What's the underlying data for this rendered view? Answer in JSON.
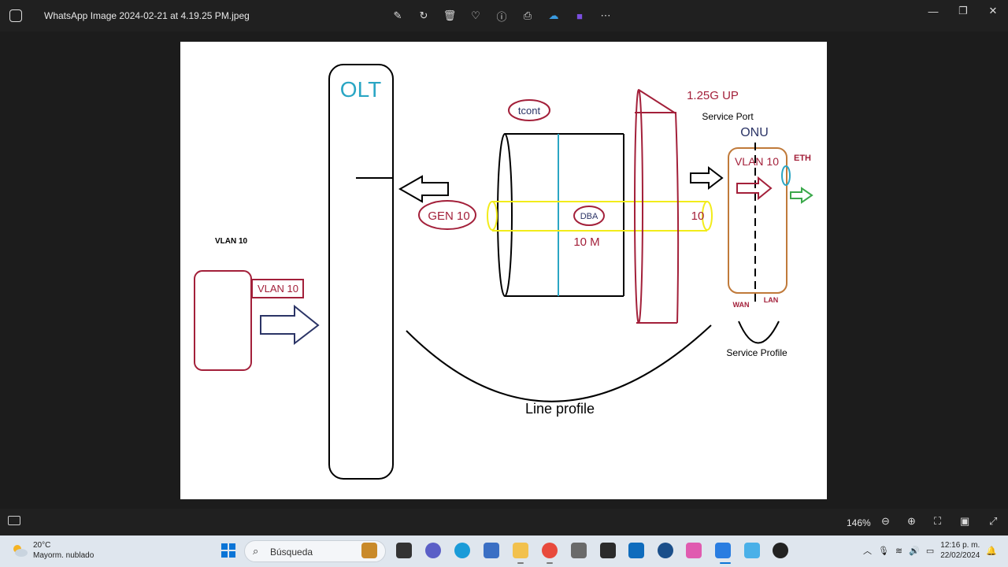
{
  "window": {
    "title": "WhatsApp Image 2024-02-21 at 4.19.25 PM.jpeg",
    "toolbar_icons": [
      "edit-icon",
      "rotate-icon",
      "delete-icon",
      "favorite-icon",
      "info-icon",
      "print-icon",
      "onedrive-icon",
      "clipchamp-icon",
      "more-icon"
    ],
    "controls": [
      "minimize-icon",
      "maximize-icon",
      "close-icon"
    ]
  },
  "diagram": {
    "olt": "OLT",
    "vlan_left_label": "VLAN 10",
    "vlan_tag": "VLAN 10",
    "tcont": "tcont",
    "gen": "GEN 10",
    "dba": "DBA",
    "ten": "10",
    "ten_m": "10 M",
    "upstream": "1.25G UP",
    "service_port": "Service Port",
    "onu": "ONU",
    "onu_vlan": "VLAN 10",
    "eth": "ETH",
    "wan": "WAN",
    "lan": "LAN",
    "service_profile": "Service Profile",
    "line_profile": "Line profile"
  },
  "statusbar": {
    "zoom": "146%"
  },
  "taskbar": {
    "temp": "20°C",
    "weather": "Mayorm. nublado",
    "search_placeholder": "Búsqueda",
    "time": "12:16 p. m.",
    "date": "22/02/2024"
  },
  "colors": {
    "crimson": "#a3203a",
    "teal": "#2aa6c4",
    "navy": "#2b3466",
    "yellow": "#f2ec1a",
    "orange": "#c07a3a",
    "green": "#3aa84a"
  }
}
